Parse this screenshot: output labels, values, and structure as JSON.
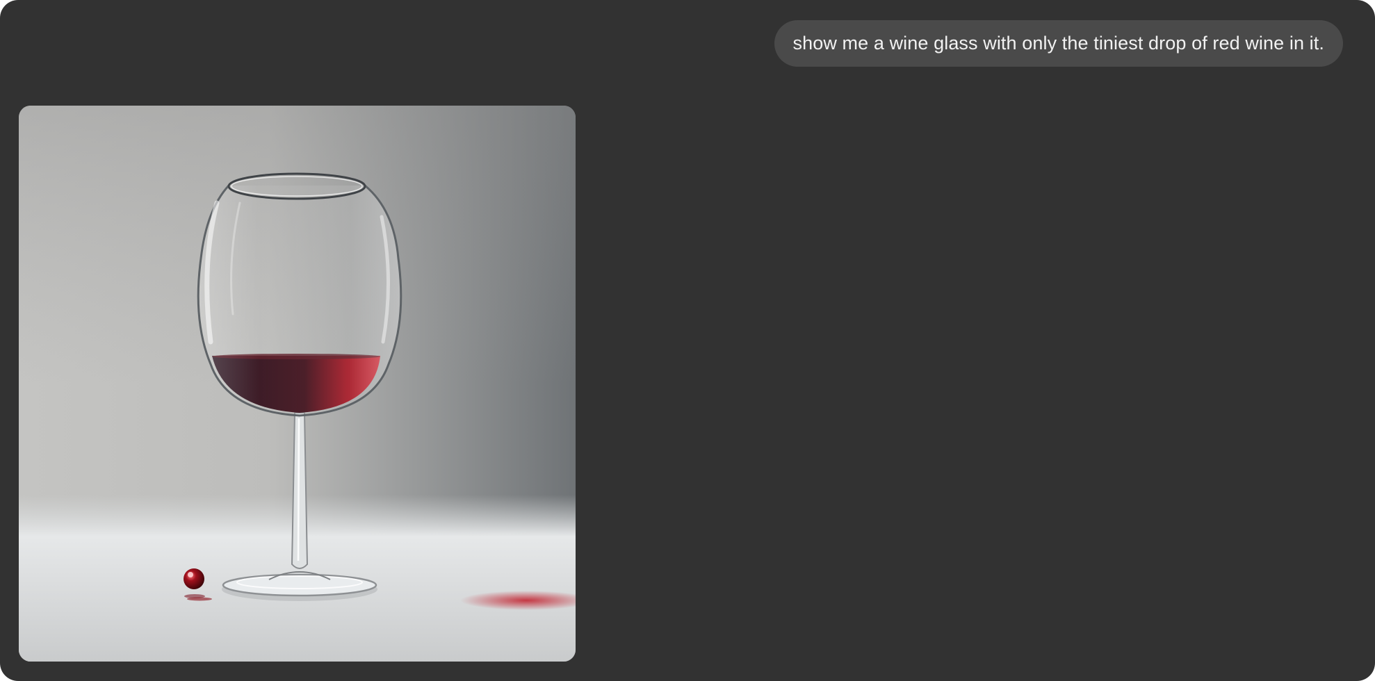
{
  "conversation": {
    "user_message": "show me a wine glass with only the tiniest drop of red wine in it."
  },
  "generated_image": {
    "subject": "wine-glass-with-red-wine",
    "colors": {
      "background": "#323232",
      "bubble": "#4a4a4a",
      "text": "#f2f2f2",
      "wine": "#7a0f1c"
    }
  }
}
